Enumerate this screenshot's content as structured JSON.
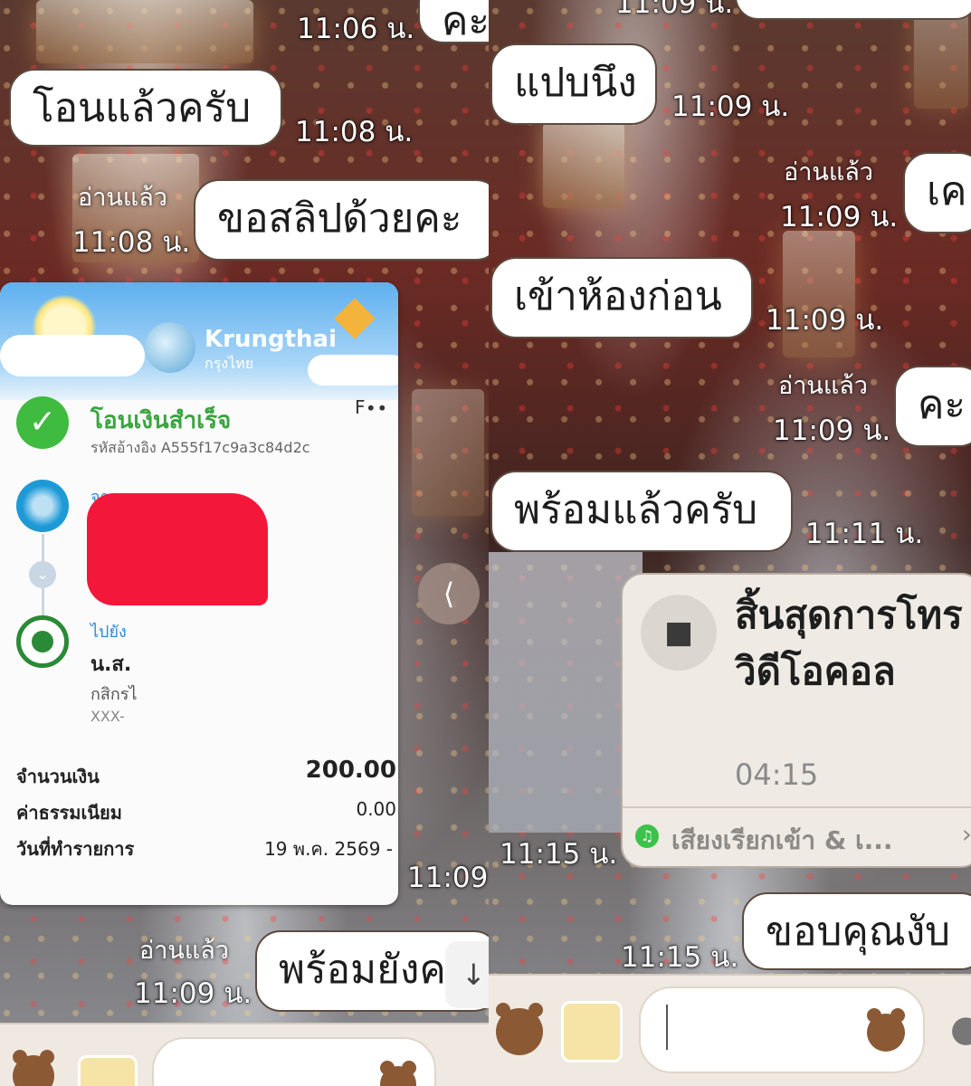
{
  "left": {
    "messages": [
      {
        "text": "คะ",
        "time": "11:06 น."
      },
      {
        "text": "โอนแล้วครับ",
        "time": "11:08 น."
      },
      {
        "text": "ขอสลิปด้วยคะ",
        "read": "อ่านแล้ว",
        "time": "11:08 น."
      },
      {
        "time": "11:09"
      },
      {
        "text": "พร้อมยังค",
        "read": "อ่านแล้ว",
        "time": "11:09 น."
      }
    ],
    "slip": {
      "brand": "Krungthai",
      "brand_th": "กรุงไทย",
      "status": "โอนเงินสำเร็จ",
      "ref": "รหัสอ้างอิง A555f17c9a3c84d2c",
      "corner": "F∙∙",
      "from_label": "จา",
      "to_label": "ไปยัง",
      "to_name": "น.ส.",
      "to_bank": "กสิกรไ",
      "to_account": "XXX-",
      "rows": [
        {
          "label": "จำนวนเงิน",
          "value": "200.00"
        },
        {
          "label": "ค่าธรรมเนียม",
          "value": "0.00"
        },
        {
          "label": "วันที่ทำรายการ",
          "value": "19 พ.ค. 2569 -"
        }
      ]
    },
    "icons": {
      "share": "share-icon",
      "scroll": "arrow-down-icon"
    }
  },
  "right": {
    "messages": [
      {
        "text": "แปบนึง",
        "time": "11:09 น."
      },
      {
        "text": "เค",
        "read": "อ่านแล้ว",
        "time": "11:09 น."
      },
      {
        "text": "เข้าห้องก่อน",
        "time": "11:09 น."
      },
      {
        "text": "คะ",
        "read": "อ่านแล้ว",
        "time": "11:09 น."
      },
      {
        "text": "พร้อมแล้วครับ",
        "time": "11:11 น."
      },
      {
        "text": "ขอบคุณงับ",
        "time": "11:15 น."
      }
    ],
    "top_time": "11:09 น.",
    "call": {
      "title": "สิ้นสุดการโทรวิดีโอคอล",
      "duration": "04:15",
      "footer": "เสียงเรียกเข้า & เ...",
      "time": "11:15 น."
    }
  },
  "colors": {
    "bubble": "#ffffff",
    "slip_green": "#39a53f",
    "redaction": "#f3173a",
    "chat_bar": "#efe9e2"
  }
}
